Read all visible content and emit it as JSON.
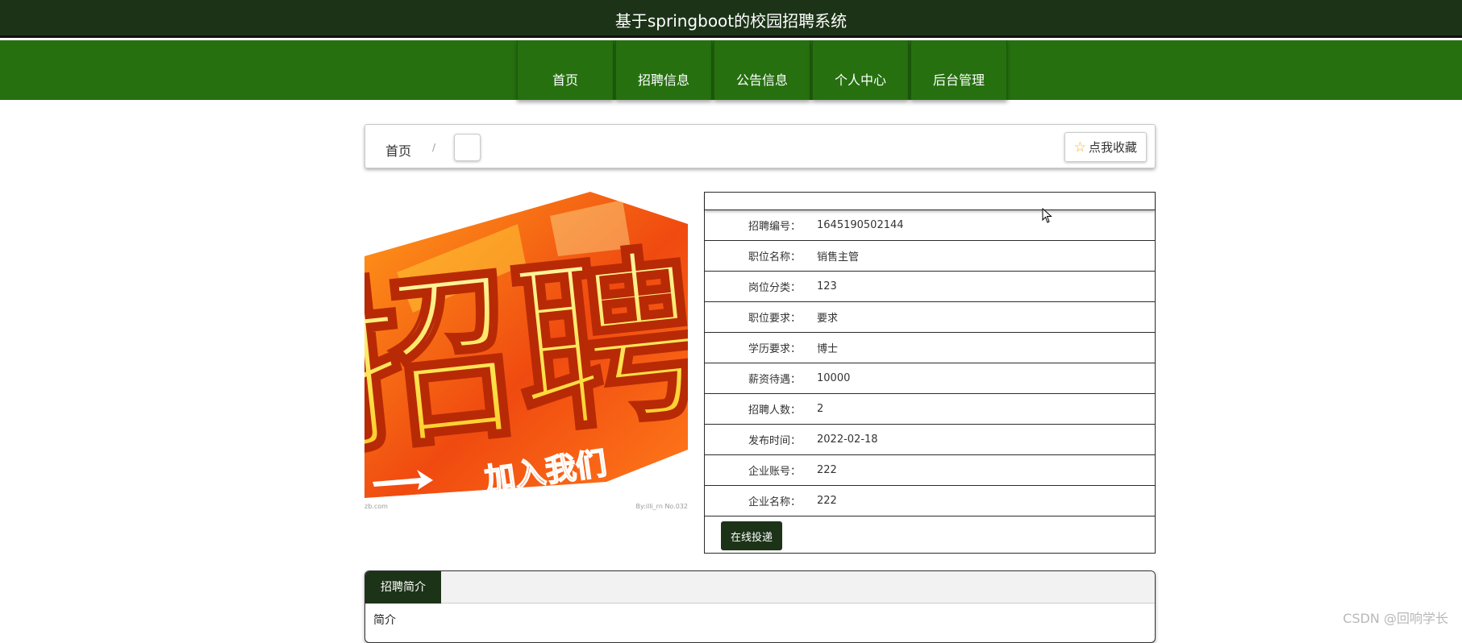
{
  "header": {
    "site_title": "基于springboot的校园招聘系统"
  },
  "nav": {
    "items": [
      "首页",
      "招聘信息",
      "公告信息",
      "个人中心",
      "后台管理"
    ]
  },
  "breadcrumb": {
    "home": "首页",
    "separator": "/"
  },
  "favorite": {
    "label": "点我收藏",
    "icon": "star-outline-icon"
  },
  "poster": {
    "main_text": "招聘",
    "sub_text": "加入我们",
    "credit_left": "zb.com",
    "credit_right": "By:illi_rn No.032"
  },
  "details": [
    {
      "label": "招聘编号：",
      "value": "1645190502144"
    },
    {
      "label": "职位名称：",
      "value": "销售主管"
    },
    {
      "label": "岗位分类：",
      "value": "123"
    },
    {
      "label": "职位要求：",
      "value": "要求"
    },
    {
      "label": "学历要求：",
      "value": "博士"
    },
    {
      "label": "薪资待遇：",
      "value": "10000"
    },
    {
      "label": "招聘人数：",
      "value": "2"
    },
    {
      "label": "发布时间：",
      "value": "2022-02-18"
    },
    {
      "label": "企业账号：",
      "value": "222"
    },
    {
      "label": "企业名称：",
      "value": "222"
    }
  ],
  "apply_button": "在线投递",
  "tabs": {
    "active": "招聘简介",
    "content": "简介"
  },
  "watermark": "CSDN @回响学长",
  "colors": {
    "topbar": "#1c3318",
    "nav": "#267010",
    "accent": "#1c3318",
    "star": "#f2b01e"
  }
}
